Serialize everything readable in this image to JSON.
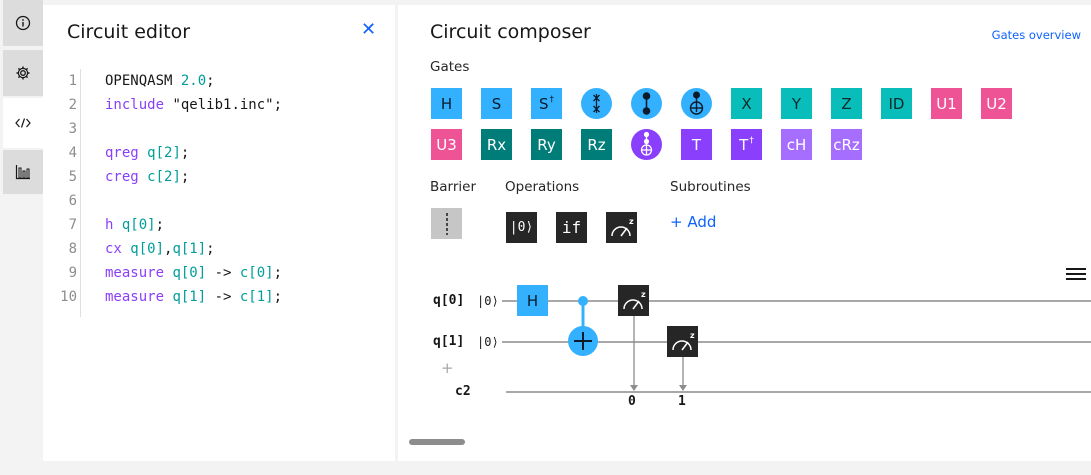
{
  "editor": {
    "title": "Circuit editor",
    "line_numbers": [
      "1",
      "2",
      "3",
      "4",
      "5",
      "6",
      "7",
      "8",
      "9",
      "10"
    ],
    "lines": [
      {
        "num": "1",
        "parts": [
          {
            "t": "OPENQASM ",
            "c": ""
          },
          {
            "t": "2.0",
            "c": "id"
          },
          {
            "t": ";",
            "c": ""
          }
        ]
      },
      {
        "num": "2",
        "parts": [
          {
            "t": "include ",
            "c": "kw"
          },
          {
            "t": "\"qelib1.inc\"",
            "c": "str"
          },
          {
            "t": ";",
            "c": ""
          }
        ]
      },
      {
        "num": "3",
        "parts": []
      },
      {
        "num": "4",
        "parts": [
          {
            "t": "qreg ",
            "c": "kw"
          },
          {
            "t": "q[2]",
            "c": "id"
          },
          {
            "t": ";",
            "c": ""
          }
        ]
      },
      {
        "num": "5",
        "parts": [
          {
            "t": "creg ",
            "c": "kw"
          },
          {
            "t": "c[2]",
            "c": "id"
          },
          {
            "t": ";",
            "c": ""
          }
        ]
      },
      {
        "num": "6",
        "parts": []
      },
      {
        "num": "7",
        "parts": [
          {
            "t": "h ",
            "c": "kw"
          },
          {
            "t": "q[0]",
            "c": "id"
          },
          {
            "t": ";",
            "c": ""
          }
        ]
      },
      {
        "num": "8",
        "parts": [
          {
            "t": "cx ",
            "c": "kw"
          },
          {
            "t": "q[0]",
            "c": "id"
          },
          {
            "t": ",",
            "c": ""
          },
          {
            "t": "q[1]",
            "c": "id"
          },
          {
            "t": ";",
            "c": ""
          }
        ]
      },
      {
        "num": "9",
        "parts": [
          {
            "t": "measure ",
            "c": "kw"
          },
          {
            "t": "q[0]",
            "c": "id"
          },
          {
            "t": " -> ",
            "c": ""
          },
          {
            "t": "c[0]",
            "c": "id"
          },
          {
            "t": ";",
            "c": ""
          }
        ]
      },
      {
        "num": "10",
        "parts": [
          {
            "t": "measure ",
            "c": "kw"
          },
          {
            "t": "q[1]",
            "c": "id"
          },
          {
            "t": " -> ",
            "c": ""
          },
          {
            "t": "c[1]",
            "c": "id"
          },
          {
            "t": ";",
            "c": ""
          }
        ]
      }
    ]
  },
  "composer": {
    "title": "Circuit composer",
    "gates_overview": "Gates overview",
    "gates_label": "Gates",
    "barrier_label": "Barrier",
    "operations_label": "Operations",
    "subroutines_label": "Subroutines",
    "add_label": "+ Add",
    "gates_row1": [
      {
        "label": "H",
        "sup": "",
        "cls": "g-blue",
        "name": "gate-h"
      },
      {
        "label": "S",
        "sup": "",
        "cls": "g-blue",
        "name": "gate-s"
      },
      {
        "label": "S",
        "sup": "†",
        "cls": "g-blue",
        "name": "gate-sdg"
      },
      {
        "label": "",
        "sup": "",
        "cls": "swap",
        "name": "gate-swap"
      },
      {
        "label": "",
        "sup": "",
        "cls": "cz",
        "name": "gate-cz"
      },
      {
        "label": "",
        "sup": "",
        "cls": "cx",
        "name": "gate-cx"
      },
      {
        "label": "X",
        "sup": "",
        "cls": "g-teal",
        "name": "gate-x"
      },
      {
        "label": "Y",
        "sup": "",
        "cls": "g-teal",
        "name": "gate-y"
      },
      {
        "label": "Z",
        "sup": "",
        "cls": "g-teal",
        "name": "gate-z"
      },
      {
        "label": "ID",
        "sup": "",
        "cls": "g-teal",
        "name": "gate-id"
      },
      {
        "label": "U1",
        "sup": "",
        "cls": "g-pink",
        "name": "gate-u1"
      },
      {
        "label": "U2",
        "sup": "",
        "cls": "g-pink",
        "name": "gate-u2"
      }
    ],
    "gates_row2": [
      {
        "label": "U3",
        "sup": "",
        "cls": "g-pink",
        "name": "gate-u3"
      },
      {
        "label": "Rx",
        "sup": "",
        "cls": "g-dteal",
        "name": "gate-rx"
      },
      {
        "label": "Ry",
        "sup": "",
        "cls": "g-dteal",
        "name": "gate-ry"
      },
      {
        "label": "Rz",
        "sup": "",
        "cls": "g-dteal",
        "name": "gate-rz"
      },
      {
        "label": "",
        "sup": "",
        "cls": "ccx",
        "name": "gate-ccx"
      },
      {
        "label": "T",
        "sup": "",
        "cls": "g-purple",
        "name": "gate-t"
      },
      {
        "label": "T",
        "sup": "†",
        "cls": "g-purple",
        "name": "gate-tdg"
      },
      {
        "label": "cH",
        "sup": "",
        "cls": "g-purple2",
        "name": "gate-ch"
      },
      {
        "label": "cRz",
        "sup": "",
        "cls": "g-purple2",
        "name": "gate-crz"
      }
    ],
    "ops": [
      {
        "label": "|0⟩",
        "name": "op-reset"
      },
      {
        "label": "if",
        "name": "op-if"
      },
      {
        "label": "",
        "name": "op-measure"
      }
    ],
    "circuit": {
      "qubits": [
        {
          "label": "q[0]",
          "ket": "|0⟩"
        },
        {
          "label": "q[1]",
          "ket": "|0⟩"
        }
      ],
      "add_qubit": "+",
      "creg": "c2",
      "h_label": "H",
      "measure_outputs": [
        "0",
        "1"
      ]
    }
  }
}
